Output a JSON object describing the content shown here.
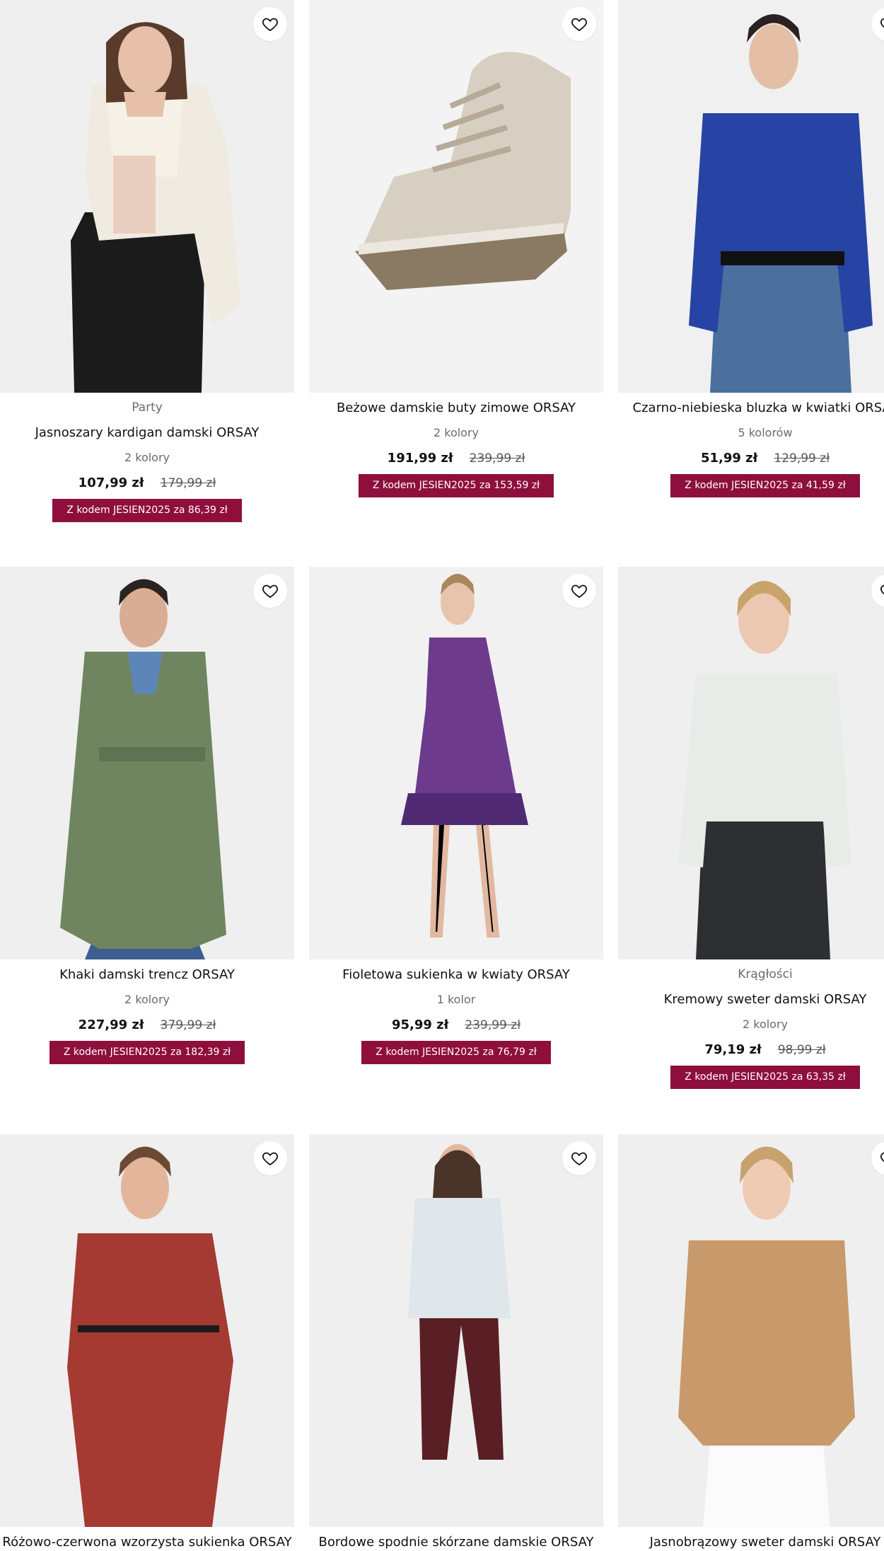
{
  "products": [
    {
      "label": "Party",
      "name": "Jasnoszary kardigan damski ORSAY",
      "colors": "2 kolory",
      "price": "107,99 zł",
      "old_price": "179,99 zł",
      "promo": "Z kodem JESIEN2025 za 86,39 zł"
    },
    {
      "label": "",
      "name": "Beżowe damskie buty zimowe ORSAY",
      "colors": "2 kolory",
      "price": "191,99 zł",
      "old_price": "239,99 zł",
      "promo": "Z kodem JESIEN2025 za 153,59 zł"
    },
    {
      "label": "",
      "name": "Czarno-niebieska bluzka w kwiatki ORSAY",
      "colors": "5 kolorów",
      "price": "51,99 zł",
      "old_price": "129,99 zł",
      "promo": "Z kodem JESIEN2025 za 41,59 zł"
    },
    {
      "label": "",
      "name": "Khaki damski trencz ORSAY",
      "colors": "2 kolory",
      "price": "227,99 zł",
      "old_price": "379,99 zł",
      "promo": "Z kodem JESIEN2025 za 182,39 zł"
    },
    {
      "label": "",
      "name": "Fioletowa sukienka w kwiaty ORSAY",
      "colors": "1 kolor",
      "price": "95,99 zł",
      "old_price": "239,99 zł",
      "promo": "Z kodem JESIEN2025 za 76,79 zł"
    },
    {
      "label": "Krągłości",
      "name": "Kremowy sweter damski ORSAY",
      "colors": "2 kolory",
      "price": "79,19 zł",
      "old_price": "98,99 zł",
      "promo": "Z kodem JESIEN2025 za 63,35 zł"
    },
    {
      "label": "",
      "name": "Różowo-czerwona wzorzysta sukienka ORSAY",
      "colors": "",
      "price": "",
      "old_price": "",
      "promo": ""
    },
    {
      "label": "",
      "name": "Bordowe spodnie skórzane damskie ORSAY",
      "colors": "",
      "price": "",
      "old_price": "",
      "promo": ""
    },
    {
      "label": "",
      "name": "Jasnobrązowy sweter damski ORSAY",
      "colors": "",
      "price": "",
      "old_price": "",
      "promo": ""
    }
  ],
  "icons": {
    "favorite": "heart-outline-icon"
  },
  "colors": {
    "promo_bg": "#8e0e3c",
    "card_bg": "#efefef"
  }
}
